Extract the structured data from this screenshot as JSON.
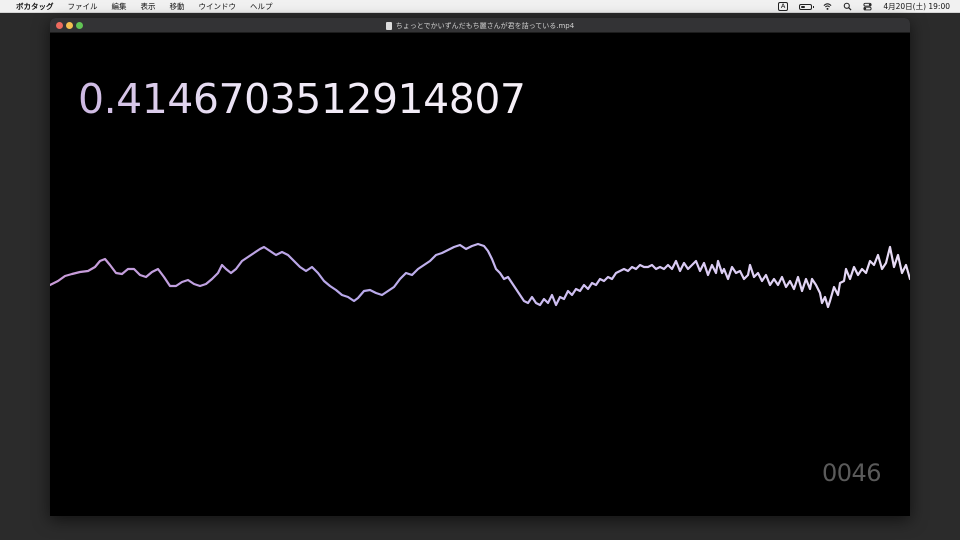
{
  "menubar": {
    "app_name": "ボカタッグ",
    "items": [
      "ファイル",
      "編集",
      "表示",
      "移動",
      "ウインドウ",
      "ヘルプ"
    ],
    "input_mode": "A",
    "clock": "4月20日(土) 19:00"
  },
  "window": {
    "title": "ちょっとでかいずんだもち麗さんが君を詰っている.mp4"
  },
  "video": {
    "value_display": "0.4146703512914807",
    "frame_counter": "0046",
    "waveform_color_start": "#c99bd8",
    "waveform_color_end": "#e8dcf5"
  }
}
